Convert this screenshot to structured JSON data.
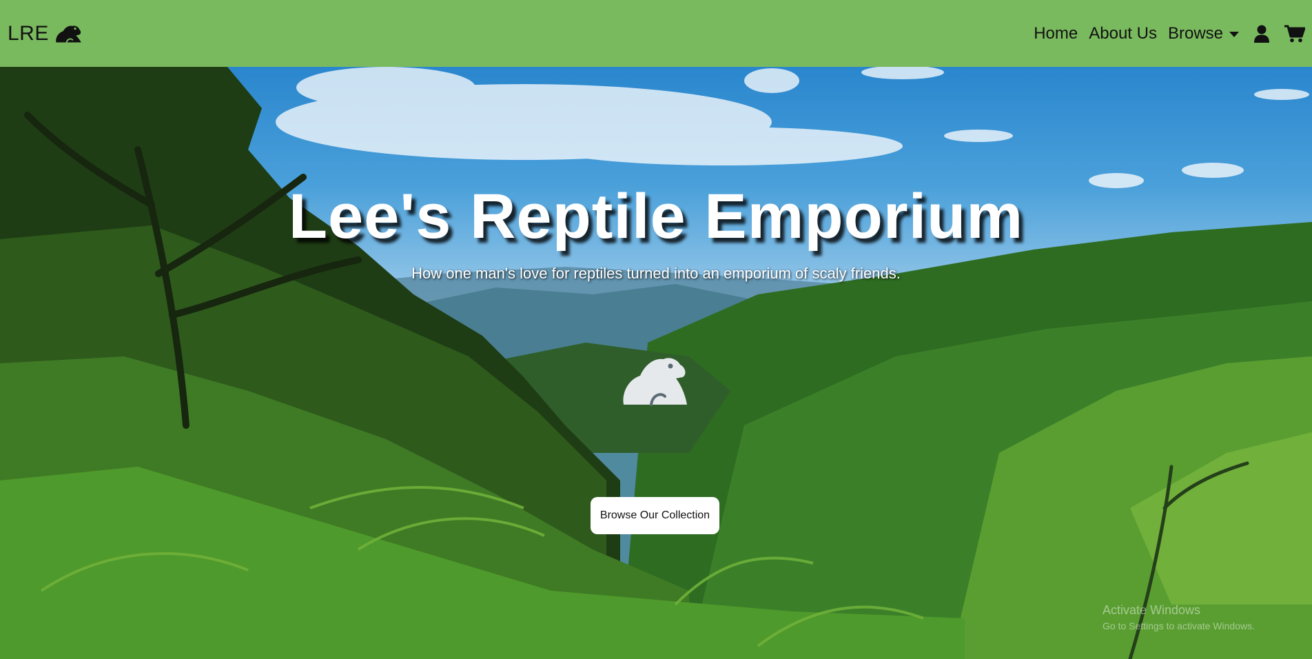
{
  "navbar": {
    "brand_text": "LRE",
    "brand_icon": "frog-icon",
    "links": [
      "Home",
      "About Us",
      "Browse"
    ],
    "account_icon": "user-icon",
    "cart_icon": "cart-icon"
  },
  "hero": {
    "title": "Lee's Reptile Emporium",
    "subtitle": "How one man's love for reptiles turned into an emporium of scaly friends.",
    "center_icon": "frog-icon",
    "cta_label": "Browse Our Collection"
  },
  "watermark": {
    "title": "Activate Windows",
    "subtitle": "Go to Settings to activate Windows."
  },
  "colors": {
    "navbar_bg": "#7aba5f",
    "button_bg": "#ffffff",
    "text_dark": "#111111"
  }
}
